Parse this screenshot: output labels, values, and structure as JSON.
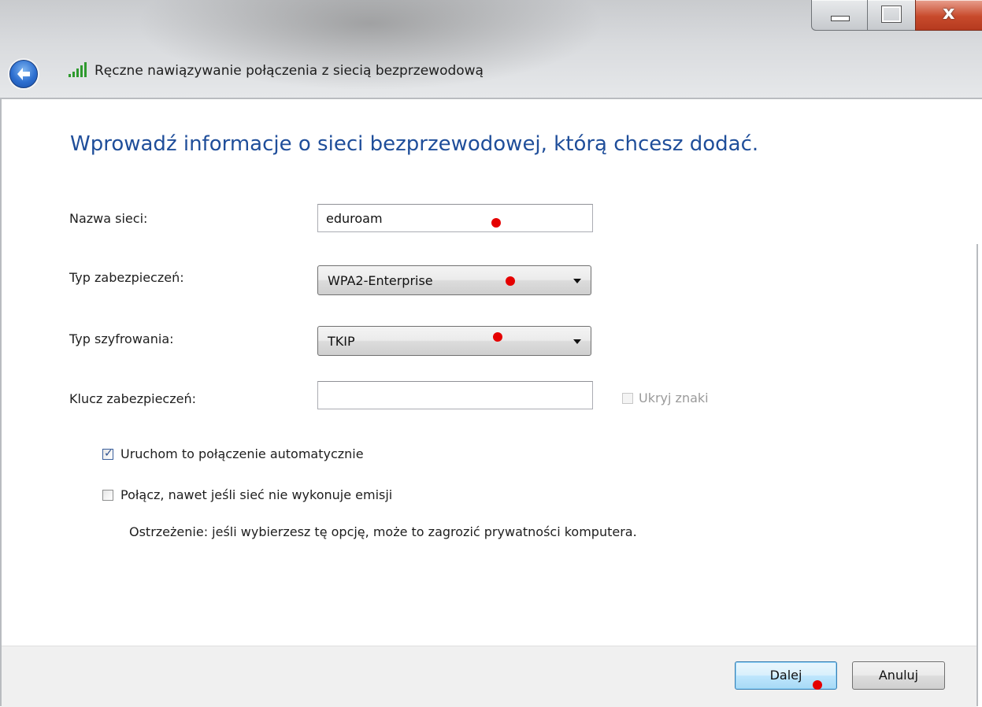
{
  "window": {
    "title": "Ręczne nawiązywanie połączenia z siecią bezprzewodową",
    "close_glyph": "x"
  },
  "form": {
    "heading": "Wprowadź informacje o sieci bezprzewodowej, którą chcesz dodać.",
    "network_name": {
      "label": "Nazwa sieci:",
      "value": "eduroam"
    },
    "security_type": {
      "label": "Typ zabezpieczeń:",
      "value": "WPA2-Enterprise"
    },
    "encryption_type": {
      "label": "Typ szyfrowania:",
      "value": "TKIP"
    },
    "security_key": {
      "label": "Klucz zabezpieczeń:",
      "value": ""
    },
    "hide_chars": {
      "label": "Ukryj znaki",
      "checked": false,
      "enabled": false
    },
    "auto_connect": {
      "label": "Uruchom to połączenie automatycznie",
      "checked": true
    },
    "connect_hidden": {
      "label": "Połącz, nawet jeśli sieć nie wykonuje emisji",
      "checked": false
    },
    "warning": "Ostrzeżenie: jeśli wybierzesz tę opcję, może to zagrozić prywatności komputera."
  },
  "footer": {
    "next_label": "Dalej",
    "cancel_label": "Anuluj"
  },
  "colors": {
    "heading": "#1f4e9a",
    "annotation_dot": "#e50000"
  }
}
